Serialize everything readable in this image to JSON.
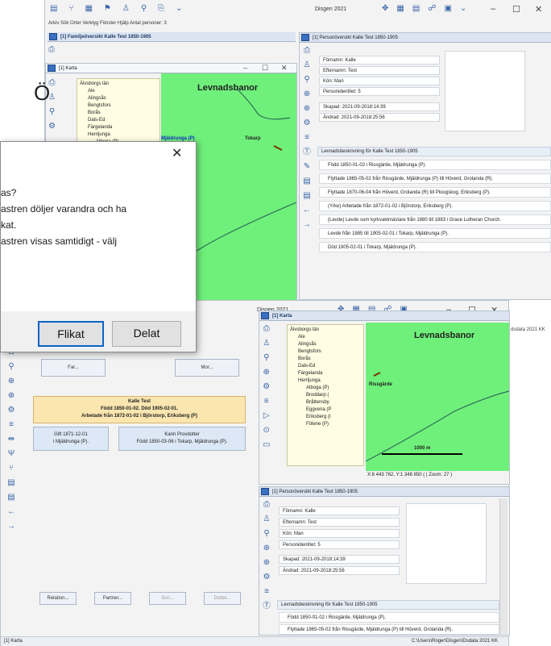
{
  "top_window": {
    "title": "Disgen 2021",
    "menu": "Arkiv   Sök   Orter   Verktyg   Fönster   Hjälp   Antal personer: 3",
    "toolbar_icons": [
      "list-icon",
      "branch-icon",
      "calendar-icon",
      "flag-icon",
      "person-icon",
      "pin-icon",
      "document-icon",
      "dropdown-icon"
    ],
    "right_toolbar_icons": [
      "move-icon",
      "grid-icon",
      "layout-icon",
      "graph-icon",
      "view-icon",
      "dropdown-icon"
    ]
  },
  "family_panel": {
    "title": "[1] Familjeöversikt Kalle Test 1850-1905"
  },
  "map_panel_top": {
    "title": "[1] Karta",
    "label": "Levnadsbanor",
    "places": [
      "Mjäldrunga (P)",
      "Tokarp"
    ],
    "tree": [
      "Älvsborgs län",
      "Ale",
      "Alingsås",
      "Bengtsfors",
      "Borås",
      "Dals-Ed",
      "Färgelanda",
      "Herrljunga",
      "Alboga (P)"
    ]
  },
  "person_panel_top": {
    "title": "[1] Personöversikt Kalle Test 1850-1905",
    "fields": [
      "Förnamn: Kalle",
      "Efternamn: Test",
      "Kön: Man",
      "Personidentitet: 5",
      "Skapad: 2021-09-2018:14:39",
      "Ändrad: 2021-09-2018:25:56"
    ],
    "desc_header": "Levnadsbeskrivning för Kalle Test 1850-1905",
    "rows": [
      "Född 1850-01-02 i Rissgärde, Mjäldrunga (P).",
      "Flyttade 1865-05-02 från Rissgärde, Mjäldrunga (P) till Höverd, Grolanda (R).",
      "Flyttade 1870-06-04 från Höverd, Grolanda (R) till Ploogskog, Eriksberg (P).",
      "(Yrke) Arbetade från 1872-01-02 i Björstorp, Eriksberg (P).",
      "(Levde) Levde som kyrkvaktmästare från 1880 till 1883 i Grace Lutheran Church.",
      "Levde från 1885 till 1905-02-01 i Tokarp, Mjäldrunga (P).",
      "Död 1905-02-01 i Tokarp, Mjäldrunga (P)."
    ]
  },
  "left_letter": "Ö",
  "dialog": {
    "close": "✕",
    "lines": [
      "as?",
      "astren döljer varandra och ha",
      "kat.",
      "astren visas samtidigt - välj"
    ],
    "btn_tabbed": "Flikat",
    "btn_split": "Delat"
  },
  "bottom_window": {
    "title": "Disgen 2021",
    "family": {
      "father": "Far...",
      "mother": "Mor...",
      "main_name": "Kalle Test",
      "main_line1": "Född 1850-01-02. Död 1905-02-01.",
      "main_line2": "Arbetade från 1872-01-02 i Björstorp, Eriksberg (P)",
      "married": "Gift 1871-12-01",
      "married_place": "i Mjäldrunga (P).",
      "spouse_name": "Karin Provdotter",
      "spouse_line": "Född 1850-03-06 i Tokarp, Mjäldrunga (P).",
      "buttons": [
        "Relation...",
        "Partner...",
        "Son...",
        "Dotter..."
      ]
    },
    "map": {
      "title": "[1] Karta",
      "label": "Levnadsbanor",
      "place": "Rissgärde",
      "scale": "1000 m",
      "coords": "X:6 443 762, Y:1 348 850 (  | Zoom: 27 )",
      "tree": [
        "Älvsborgs län",
        "Ale",
        "Alingsås",
        "Bengtsfors",
        "Borås",
        "Dals-Ed",
        "Färgelanda",
        "Herrljunga",
        "Alboga (P)",
        "Broddarp (",
        "Bråttensby",
        "Eggvena (P",
        "Eriksberg (I",
        "Fölene (P)"
      ]
    },
    "person": {
      "title": "[1] Personöversikt Kalle Test 1850-1905",
      "fields": [
        "Förnamn: Kalle",
        "Efternamn: Test",
        "Kön: Man",
        "Personidentitet: 5",
        "Skapad: 2021-09-2018:14:39",
        "Ändrad: 2021-09-2018:25:56"
      ],
      "desc_header": "Levnadsbeskrivning för Kalle Test 1850-1905",
      "rows": [
        "Född 1850-01-02 i Rissgärde, Mjäldrunga (P).",
        "Flyttade 1865-05-02 från Rissgärde, Mjäldrunga (P) till Höverd, Grolanda (R)."
      ]
    },
    "status_left": "[1] Karta",
    "status_right": "C:\\Users\\Roger\\Disgen\\Dsdata 2021 KK"
  },
  "side_status": "dsdata 2021 KK"
}
